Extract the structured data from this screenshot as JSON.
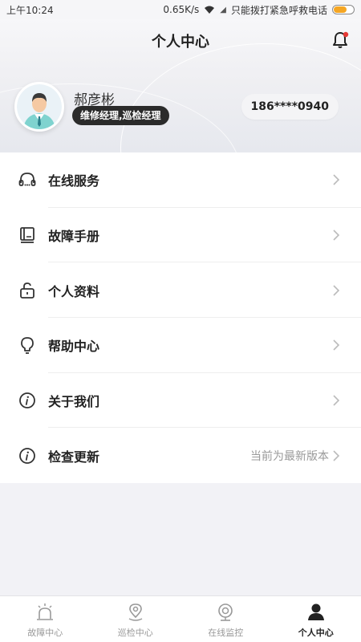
{
  "status_bar": {
    "time": "上午10:24",
    "speed": "0.65K/s",
    "emergency": "只能拨打紧急呼救电话"
  },
  "header": {
    "title": "个人中心",
    "user_name": "郝彦彬",
    "role": "维修经理,巡检经理",
    "phone": "186****0940",
    "notification_icon": "bell-icon"
  },
  "menu": {
    "items": [
      {
        "label": "在线服务",
        "icon": "headset-icon",
        "value": ""
      },
      {
        "label": "故障手册",
        "icon": "book-icon",
        "value": ""
      },
      {
        "label": "个人资料",
        "icon": "lock-icon",
        "value": ""
      },
      {
        "label": "帮助中心",
        "icon": "lightbulb-icon",
        "value": ""
      },
      {
        "label": "关于我们",
        "icon": "info-icon",
        "value": ""
      },
      {
        "label": "检查更新",
        "icon": "info-icon",
        "value": "当前为最新版本"
      }
    ]
  },
  "tabbar": {
    "tabs": [
      {
        "label": "故障中心",
        "icon": "alarm-icon",
        "active": false
      },
      {
        "label": "巡检中心",
        "icon": "location-pin-icon",
        "active": false
      },
      {
        "label": "在线监控",
        "icon": "camera-icon",
        "active": false
      },
      {
        "label": "个人中心",
        "icon": "person-icon",
        "active": true
      }
    ]
  },
  "colors": {
    "accent_dark": "#2b2b2b",
    "battery": "#f5a623",
    "notification_dot": "#e53935"
  }
}
